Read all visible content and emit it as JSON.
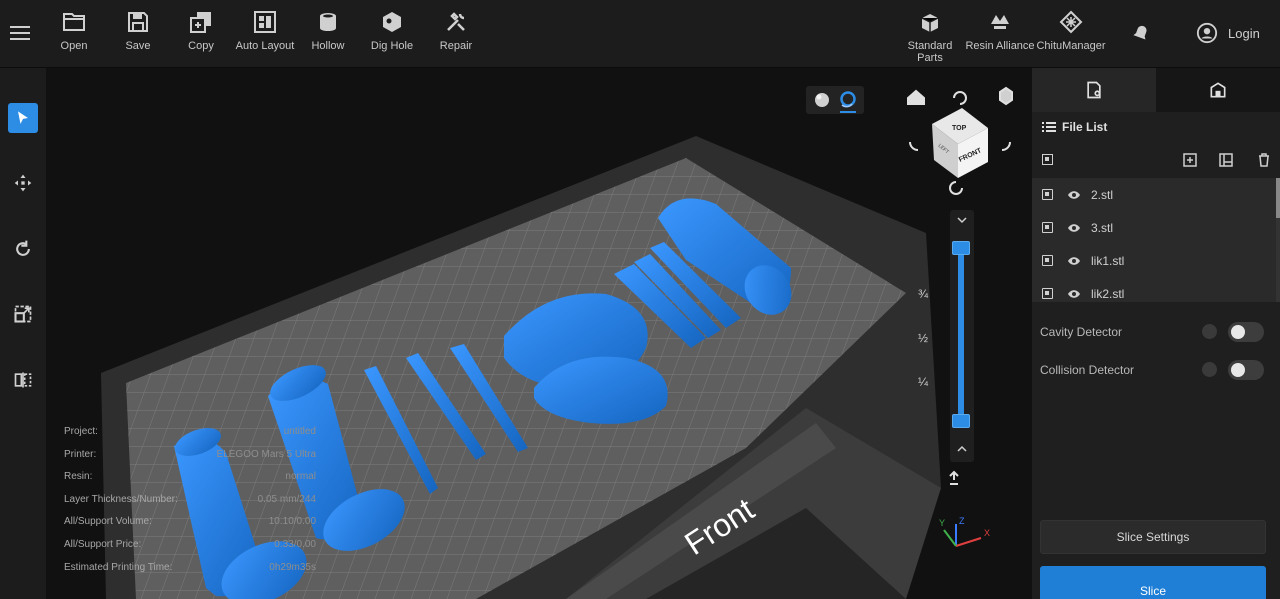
{
  "toolbar": {
    "items": [
      {
        "label": "Open",
        "icon": "folder-icon"
      },
      {
        "label": "Save",
        "icon": "floppy-icon"
      },
      {
        "label": "Copy",
        "icon": "copy-icon"
      },
      {
        "label": "Auto Layout",
        "icon": "auto-layout-icon"
      },
      {
        "label": "Hollow",
        "icon": "hollow-icon"
      },
      {
        "label": "Dig Hole",
        "icon": "dig-hole-icon"
      },
      {
        "label": "Repair",
        "icon": "repair-icon"
      }
    ],
    "right_items": [
      {
        "label": "Standard Parts",
        "icon": "standard-parts-icon"
      },
      {
        "label": "Resin Alliance",
        "icon": "resin-alliance-icon"
      },
      {
        "label": "ChituManager",
        "icon": "chitu-manager-icon"
      }
    ],
    "login_label": "Login"
  },
  "info": {
    "rows": [
      {
        "key": "Project:",
        "value": "untitled"
      },
      {
        "key": "Printer:",
        "value": "ELEGOO Mars 5 Ultra"
      },
      {
        "key": "Resin:",
        "value": "normal"
      },
      {
        "key": "Layer Thickness/Number:",
        "value": "0.05 mm/244"
      },
      {
        "key": "All/Support Volume:",
        "value": "10.10/0.00"
      },
      {
        "key": "All/Support Price:",
        "value": "0.33/0.00"
      },
      {
        "key": "Estimated Printing Time:",
        "value": "0h29m35s"
      }
    ]
  },
  "viewport": {
    "front_label": "Front",
    "cube_faces": {
      "top": "TOP",
      "front": "FRONT",
      "left": "LEFT"
    },
    "slider_marks": [
      "3/4",
      "1/2",
      "1/4"
    ],
    "slider_marks_display": [
      "¾",
      "½",
      "¼"
    ],
    "axes": {
      "x": "X",
      "y": "Y",
      "z": "Z"
    }
  },
  "panel": {
    "file_list_title": "File List",
    "files": [
      "2.stl",
      "3.stl",
      "lik1.stl",
      "lik2.stl"
    ],
    "cavity_detector_label": "Cavity Detector",
    "collision_detector_label": "Collision Detector",
    "slice_settings_label": "Slice Settings",
    "slice_label": "Slice"
  },
  "colors": {
    "accent": "#2d8ce4",
    "model": "#1f7ad6",
    "background": "#141414",
    "panel": "#1f1f1f"
  }
}
